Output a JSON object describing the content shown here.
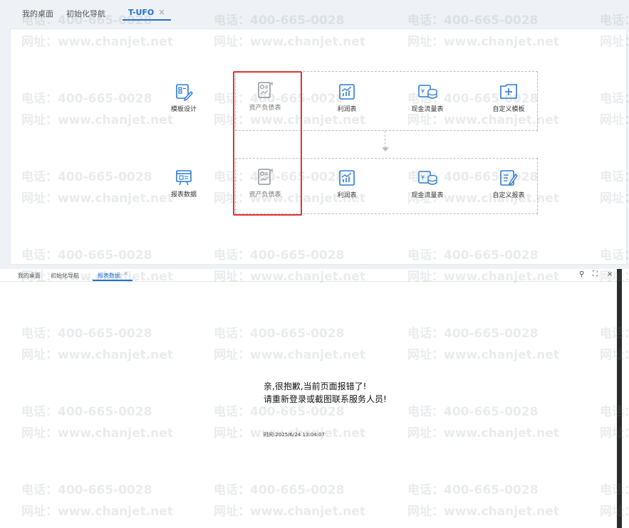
{
  "top_panel": {
    "tabs": [
      {
        "label": "我的桌面"
      },
      {
        "label": "初始化导航"
      },
      {
        "label": "T-UFO"
      }
    ],
    "close_glyph": "×",
    "template_row": {
      "title": "模板设计",
      "items": [
        "资产负债表",
        "利润表",
        "现金流量表",
        "自定义模板"
      ]
    },
    "data_row": {
      "title": "报表数据",
      "items": [
        "资产负债表",
        "利润表",
        "现金流量表",
        "自定义报表"
      ]
    },
    "icons": {
      "template_design": "template-design-icon",
      "report_data": "report-data-icon",
      "balance_sheet": "balance-sheet-icon",
      "profit": "profit-chart-icon",
      "cash_flow": "cash-flow-icon",
      "custom_template": "custom-template-icon",
      "custom_report": "custom-report-icon"
    },
    "highlight_color": "#e0342f",
    "accent_color": "#1f6fd1"
  },
  "bottom_panel": {
    "tabs": [
      {
        "label": "我的桌面"
      },
      {
        "label": "初始化导航"
      },
      {
        "label": "报表数据"
      }
    ],
    "close_glyph": "×",
    "window_controls": {
      "search": "⚲",
      "maximize": "⛶",
      "close": "×"
    },
    "error": {
      "line1": "亲,很抱歉,当前页面报错了!",
      "line2": "请重新登录或截图联系服务人员!",
      "time": "时间:2025/6/24 13:04:07"
    }
  },
  "watermark": {
    "phone": "电话：400-665-0028",
    "site": "网址：www.chanjet.net"
  }
}
